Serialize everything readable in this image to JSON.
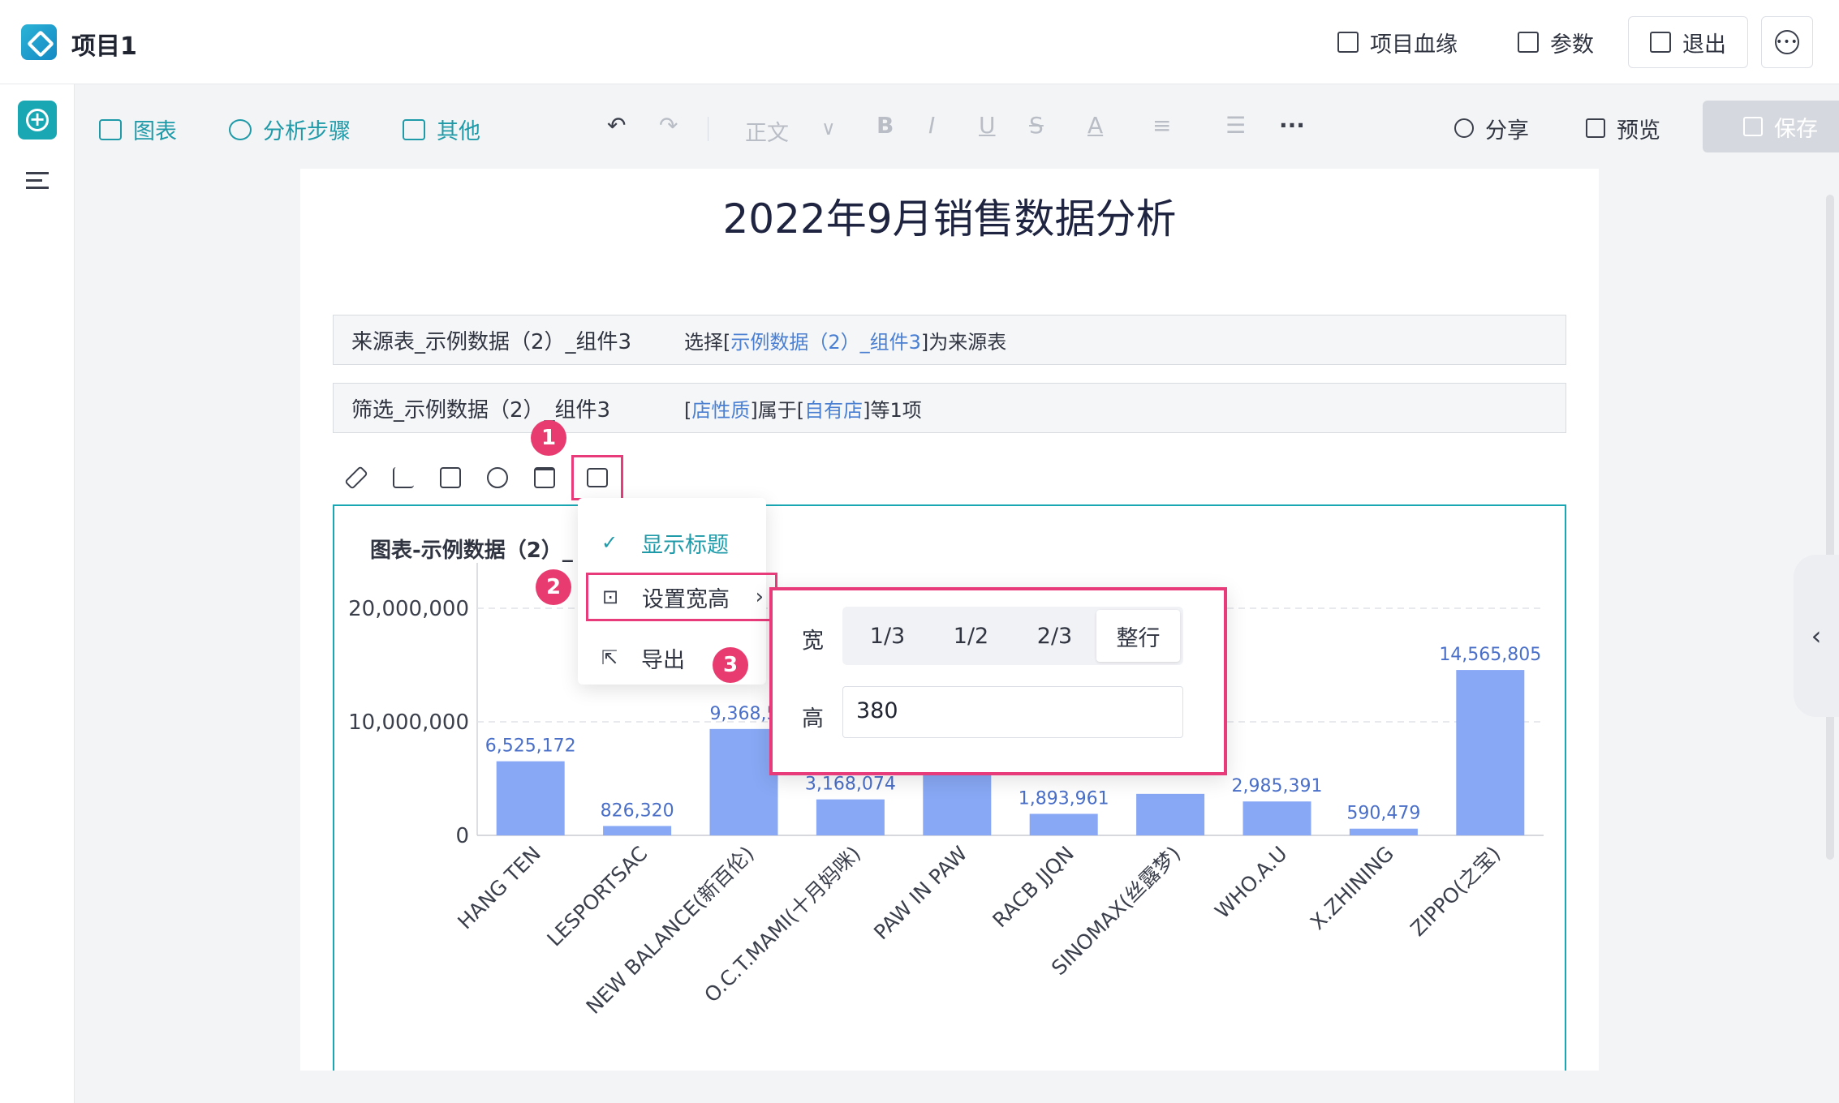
{
  "topbar": {
    "title": "项目1",
    "lineage_label": "项目血缘",
    "params_label": "参数",
    "exit_label": "退出"
  },
  "toolbar": {
    "chart_label": "图表",
    "steps_label": "分析步骤",
    "other_label": "其他",
    "text_style": "正文",
    "share_label": "分享",
    "preview_label": "预览",
    "save_label": "保存"
  },
  "doc": {
    "title": "2022年9月销售数据分析",
    "cmd1": {
      "name": "来源表_示例数据（2）_组件3",
      "desc_pre": "选择[",
      "desc_link": "示例数据（2）_组件3",
      "desc_post": "]为来源表"
    },
    "cmd2": {
      "name": "筛选_示例数据（2）_组件3",
      "p1": "[",
      "link1": "店性质",
      "p2": "]属于[",
      "link2": "自有店",
      "p3": "]等1项"
    },
    "chart_title": "图表-示例数据（2）_"
  },
  "menu": {
    "show_title": "显示标题",
    "set_size": "设置宽高",
    "export": "导出"
  },
  "size_panel": {
    "width_label": "宽",
    "width_options": [
      "1/3",
      "1/2",
      "2/3",
      "整行"
    ],
    "selected_width": "整行",
    "height_label": "高",
    "height_value": "380"
  },
  "badges": [
    "1",
    "2",
    "3"
  ],
  "chart_data": {
    "type": "bar",
    "categories": [
      "HANG TEN",
      "LESPORTSAC",
      "NEW BALANCE(新百伦)",
      "O.C.T.MAMI(十月妈咪)",
      "PAW IN PAW",
      "RACB JJQN",
      "SINOMAX(丝露梦)",
      "WHO.A.U",
      "X.ZHINING",
      "ZIPPO(之宝)"
    ],
    "values": [
      6525172,
      826320,
      9368590,
      3168074,
      5400000,
      1893961,
      3654100,
      2985391,
      590479,
      14565805
    ],
    "data_labels": [
      "6,525,172",
      "826,320",
      "9,368,5",
      "3,168,074",
      "",
      "1,893,961",
      "",
      "2,985,391",
      "590,479",
      "14,565,805"
    ],
    "ytick_labels": [
      "0",
      "10,000,000",
      "20,000,000"
    ],
    "ylim": [
      0,
      24000000
    ],
    "bar_color": "#88a8f5",
    "label_color": "#4a6fc8",
    "grid": true
  },
  "colors": {
    "accent": "#19a7b4",
    "highlight": "#e83b7a"
  }
}
